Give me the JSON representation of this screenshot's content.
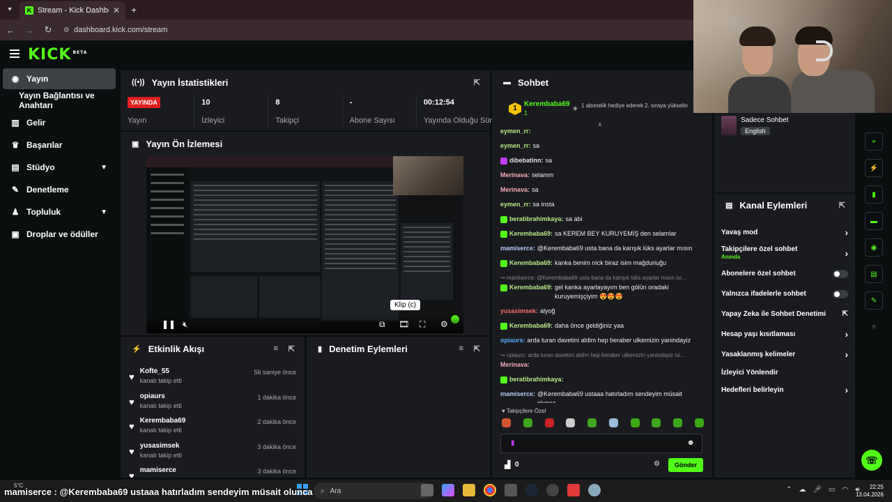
{
  "browser": {
    "tab_title": "Stream - Kick Dashboard",
    "url": "dashboard.kick.com/stream"
  },
  "brand": {
    "logo": "KICK",
    "logo_tag": "BETA",
    "accent": "#53fc18"
  },
  "sidebar": {
    "items": [
      {
        "label": "Yayın",
        "icon": "broadcast-icon"
      },
      {
        "label": "Yayın Bağlantısı ve Anahtarı",
        "icon": ""
      },
      {
        "label": "Gelir",
        "icon": "chart-icon"
      },
      {
        "label": "Başarılar",
        "icon": "trophy-icon"
      },
      {
        "label": "Stüdyo",
        "icon": "grid-icon"
      },
      {
        "label": "Denetleme",
        "icon": "wrench-icon"
      },
      {
        "label": "Topluluk",
        "icon": "community-icon"
      },
      {
        "label": "Droplar ve ödüller",
        "icon": "gift-icon"
      }
    ]
  },
  "stats": {
    "title": "Yayın İstatistikleri",
    "live_badge": "YAYINDA",
    "cells": [
      {
        "value": "",
        "label": "Yayın"
      },
      {
        "value": "10",
        "label": "İzleyici"
      },
      {
        "value": "8",
        "label": "Takipçi"
      },
      {
        "value": "-",
        "label": "Abone Sayısı"
      },
      {
        "value": "00:12:54",
        "label": "Yayında Olduğu Süre"
      }
    ]
  },
  "preview": {
    "title": "Yayın Ön İzlemesi",
    "tooltip": "Klip (c)"
  },
  "activity": {
    "title": "Etkinlik Akışı",
    "items": [
      {
        "name": "Kofte_55",
        "sub": "kanalı takip etti",
        "time": "56 saniye önce"
      },
      {
        "name": "opiaurs",
        "sub": "kanalı takip etti",
        "time": "1 dakika önce"
      },
      {
        "name": "Kerembaba69",
        "sub": "kanalı takip etti",
        "time": "2 dakika önce"
      },
      {
        "name": "yusasimsek",
        "sub": "kanalı takip etti",
        "time": "3 dakika önce"
      },
      {
        "name": "mamiserce",
        "sub": "",
        "time": "3 dakika önce"
      }
    ]
  },
  "moderation": {
    "title": "Denetim Eylemleri"
  },
  "chat": {
    "title": "Sohbet",
    "pinned": {
      "user": "Kerembaba69",
      "count": "1",
      "text": "1 abonelik hediye ederek 2. sıraya yükselin"
    },
    "messages": [
      {
        "user": "eymen_rr:",
        "text": "",
        "color": "#b8e986",
        "badge": false
      },
      {
        "user": "eymen_rr:",
        "text": "sa",
        "color": "#b8e986",
        "badge": false
      },
      {
        "user": "dibebatinn:",
        "text": "sa",
        "color": "#e3e3e3",
        "badge": true,
        "badge_color": "#c33bff"
      },
      {
        "user": "Merinava:",
        "text": "selamm",
        "color": "#f5a9b8",
        "badge": false
      },
      {
        "user": "Merinava:",
        "text": "sa",
        "color": "#f5a9b8",
        "badge": false
      },
      {
        "user": "eymen_rr:",
        "text": "sa insta",
        "color": "#b8e986",
        "badge": false
      },
      {
        "user": "beratibrahimkaya:",
        "text": "sa abi",
        "color": "#b8e986",
        "badge": true,
        "badge_color": "#53fc18"
      },
      {
        "user": "Kerembaba69:",
        "text": "sa KEREM BEY KURUYEMİŞ den selamlar",
        "color": "#b8e986",
        "badge": true,
        "badge_color": "#53fc18"
      },
      {
        "user": "mamiserce:",
        "text": "@Kerembaba69 usta bana da karışık lüks ayarlar mısın",
        "color": "#b5c7f5",
        "badge": false
      },
      {
        "user": "Kerembaba69:",
        "text": "kanka benim nick biraz isim mağduriuğu",
        "color": "#b8e986",
        "badge": true,
        "badge_color": "#53fc18"
      },
      {
        "user": "",
        "text": "↪ mamiserce: @Kerembaba69 usta bana da karışık lüks ayarlar mısın isi...",
        "color": "#888",
        "badge": false,
        "reply": true
      },
      {
        "user": "Kerembaba69:",
        "text": "gel kanka ayarlayayım ben gölün oradaki kuruyemişçiyim 😍😍😍",
        "color": "#b8e986",
        "badge": true,
        "badge_color": "#53fc18"
      },
      {
        "user": "yusasimsek:",
        "text": "alyoğ",
        "color": "#ff6b6b",
        "badge": false
      },
      {
        "user": "Kerembaba69:",
        "text": "daha önce geldiğiniz yaa",
        "color": "#b8e986",
        "badge": true,
        "badge_color": "#53fc18"
      },
      {
        "user": "opiaurs:",
        "text": "arda turan davetini aldim hep beraber ulkemizin yanindayiz",
        "color": "#5aa9ff",
        "badge": false
      },
      {
        "user": "",
        "text": "↪ opiaurs: arda turan davetini aldim hep beraber ulkemizin yanindayiz isi...",
        "color": "#888",
        "badge": false,
        "reply": true
      },
      {
        "user": "Merinava:",
        "text": "",
        "color": "#f5a9b8",
        "badge": false
      },
      {
        "user": "beratibrahimkaya:",
        "text": "",
        "color": "#b8e986",
        "badge": true,
        "badge_color": "#53fc18"
      },
      {
        "user": "mamiserce:",
        "text": "@Kerembaba69 ustaaa hatırladım sendeyim müsait olunca",
        "color": "#b5c7f5",
        "badge": false
      }
    ],
    "followers_only": "Takipçilere Özel",
    "send_label": "Gönder",
    "point_count": "0"
  },
  "channel_info": {
    "mode": "Sadece Sohbet",
    "language": "English"
  },
  "channel_actions": {
    "title": "Kanal Eylemleri",
    "items": [
      {
        "label": "Yavaş mod",
        "control": "chevron",
        "sub": ""
      },
      {
        "label": "Takipçilere özel sohbet",
        "control": "chevron",
        "sub": "Anında"
      },
      {
        "label": "Abonelere özel sohbet",
        "control": "toggle",
        "sub": ""
      },
      {
        "label": "Yalnızca ifadelerle sohbet",
        "control": "toggle",
        "sub": ""
      },
      {
        "label": "Yapay Zeka ile Sohbet Denetimi",
        "control": "external",
        "sub": ""
      },
      {
        "label": "Hesap yaşı kısıtlaması",
        "control": "chevron",
        "sub": ""
      },
      {
        "label": "Yasaklanmış kelimeler",
        "control": "chevron",
        "sub": ""
      },
      {
        "label": "İzleyici Yönlendir",
        "control": "none",
        "sub": ""
      },
      {
        "label": "Hedefleri belirleyin",
        "control": "chevron",
        "sub": ""
      }
    ]
  },
  "overlay_caption": {
    "user": "mamiserce :",
    "text": "@Kerembaba69 ustaaa hatırladım sendeyim müsait olunca"
  },
  "taskbar": {
    "weather": "5°C",
    "search_placeholder": "Ara",
    "time": "22:25",
    "date": "13.04.2026"
  }
}
